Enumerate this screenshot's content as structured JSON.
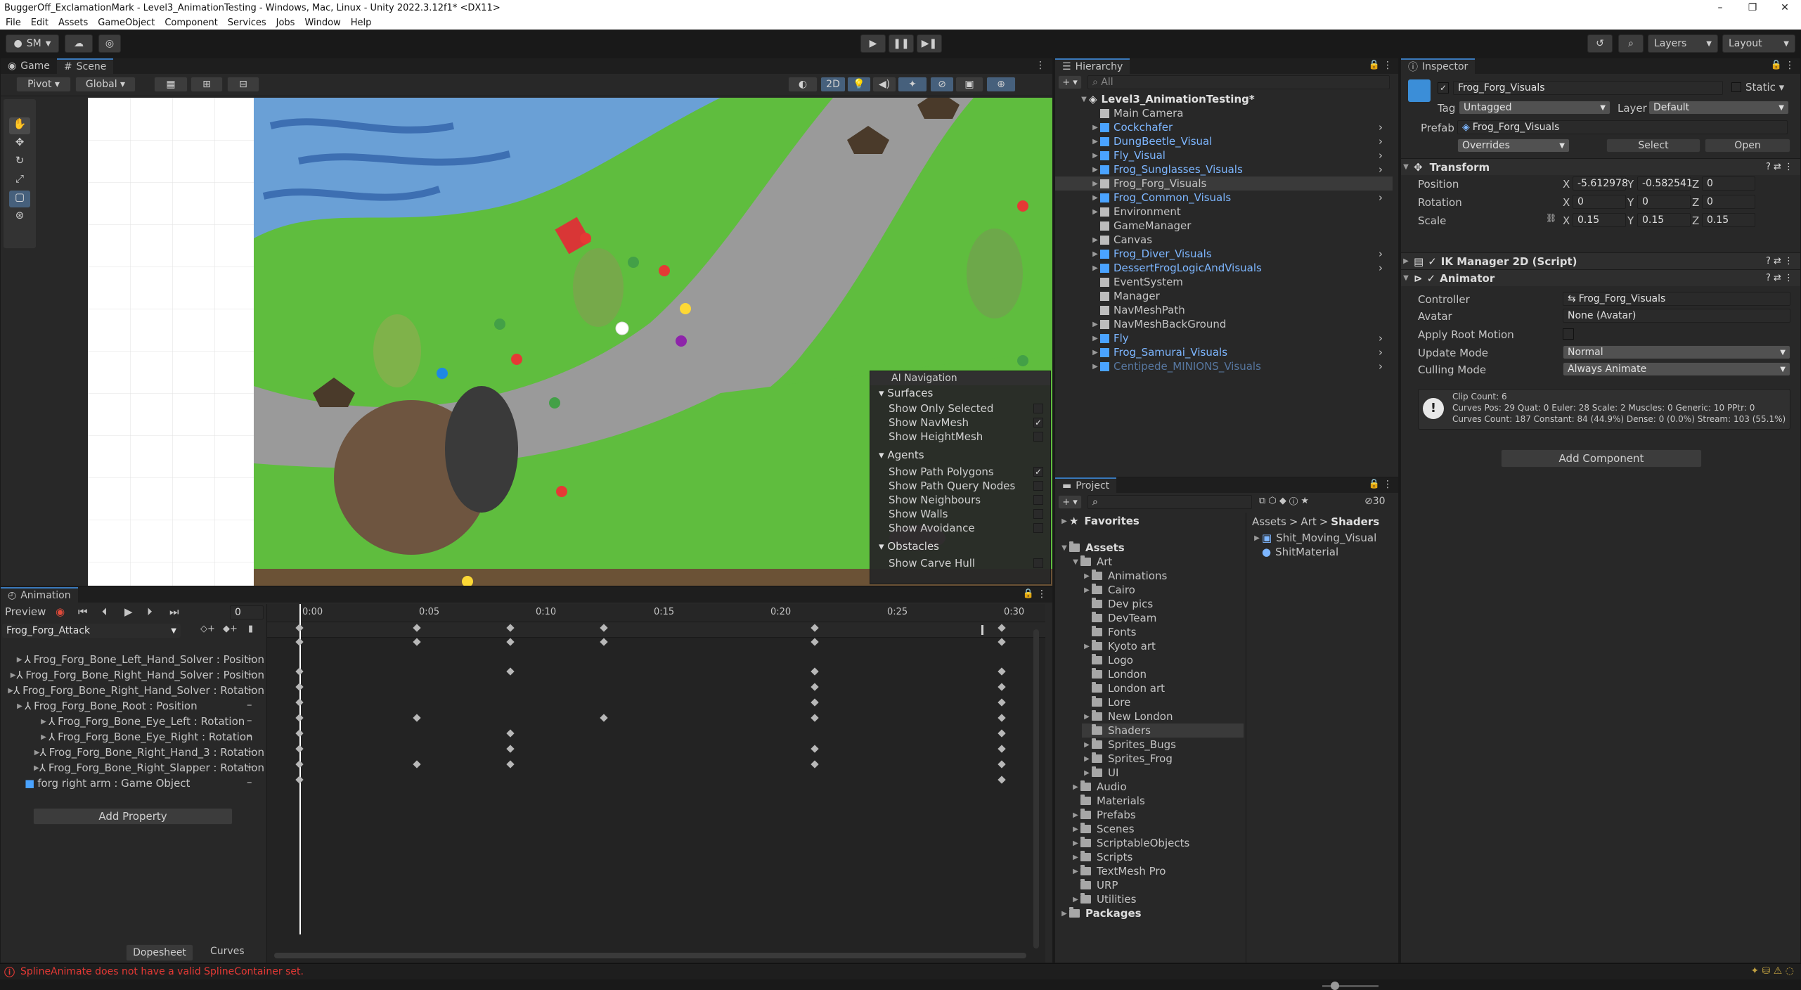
{
  "window": {
    "title": "BuggerOff_ExclamationMark - Level3_AnimationTesting - Windows, Mac, Linux - Unity 2022.3.12f1* <DX11>",
    "min": "–",
    "max": "❐",
    "close": "✕"
  },
  "menu": [
    "File",
    "Edit",
    "Assets",
    "GameObject",
    "Component",
    "Services",
    "Jobs",
    "Window",
    "Help"
  ],
  "toolbar": {
    "account": "SM",
    "layers": "Layers",
    "layout": "Layout"
  },
  "scene": {
    "tabs": [
      "Game",
      "Scene"
    ],
    "pivot": "Pivot",
    "global": "Global",
    "mode2d": "2D"
  },
  "ai_navigation": {
    "title": "AI Navigation",
    "surfaces": {
      "label": "Surfaces",
      "items": [
        {
          "label": "Show Only Selected",
          "checked": false
        },
        {
          "label": "Show NavMesh",
          "checked": true
        },
        {
          "label": "Show HeightMesh",
          "checked": false
        }
      ]
    },
    "agents": {
      "label": "Agents",
      "items": [
        {
          "label": "Show Path Polygons",
          "checked": true
        },
        {
          "label": "Show Path Query Nodes",
          "checked": false
        },
        {
          "label": "Show Neighbours",
          "checked": false
        },
        {
          "label": "Show Walls",
          "checked": false
        },
        {
          "label": "Show Avoidance",
          "checked": false
        }
      ]
    },
    "obstacles": {
      "label": "Obstacles",
      "items": [
        {
          "label": "Show Carve Hull",
          "checked": false
        }
      ]
    }
  },
  "hierarchy": {
    "tab": "Hierarchy",
    "search_placeholder": "All",
    "scene": "Level3_AnimationTesting*",
    "items": [
      {
        "label": "Main Camera",
        "prefab": false,
        "expand": false
      },
      {
        "label": "Cockchafer",
        "prefab": true,
        "expand": true
      },
      {
        "label": "DungBeetle_Visual",
        "prefab": true,
        "expand": true
      },
      {
        "label": "Fly_Visual",
        "prefab": true,
        "expand": true
      },
      {
        "label": "Frog_Sunglasses_Visuals",
        "prefab": true,
        "expand": true
      },
      {
        "label": "Frog_Forg_Visuals",
        "prefab": false,
        "expand": true,
        "selected": true
      },
      {
        "label": "Frog_Common_Visuals",
        "prefab": true,
        "expand": true
      },
      {
        "label": "Environment",
        "prefab": false,
        "expand": true
      },
      {
        "label": "GameManager",
        "prefab": false,
        "expand": false
      },
      {
        "label": "Canvas",
        "prefab": false,
        "expand": true
      },
      {
        "label": "Frog_Diver_Visuals",
        "prefab": true,
        "expand": true
      },
      {
        "label": "DessertFrogLogicAndVisuals",
        "prefab": true,
        "expand": true
      },
      {
        "label": "EventSystem",
        "prefab": false,
        "expand": false
      },
      {
        "label": "Manager",
        "prefab": false,
        "expand": false
      },
      {
        "label": "NavMeshPath",
        "prefab": false,
        "expand": false
      },
      {
        "label": "NavMeshBackGround",
        "prefab": false,
        "expand": true
      },
      {
        "label": "Fly",
        "prefab": true,
        "expand": true
      },
      {
        "label": "Frog_Samurai_Visuals",
        "prefab": true,
        "expand": true
      },
      {
        "label": "Centipede_MINIONS_Visuals",
        "prefab": true,
        "expand": true,
        "dim": true
      }
    ]
  },
  "inspector": {
    "tab": "Inspector",
    "object_name": "Frog_Forg_Visuals",
    "static": "Static",
    "tag_label": "Tag",
    "tag": "Untagged",
    "layer_label": "Layer",
    "layer": "Default",
    "prefab_label": "Prefab",
    "prefab": "Frog_Forg_Visuals",
    "overrides": "Overrides",
    "select": "Select",
    "open": "Open",
    "transform": {
      "title": "Transform",
      "position_label": "Position",
      "rotation_label": "Rotation",
      "scale_label": "Scale",
      "position": {
        "x": "-5.612978",
        "y": "-0.582541",
        "z": "0"
      },
      "rotation": {
        "x": "0",
        "y": "0",
        "z": "0"
      },
      "scale": {
        "x": "0.15",
        "y": "0.15",
        "z": "0.15"
      }
    },
    "ik_manager": "IK Manager 2D (Script)",
    "animator": {
      "title": "Animator",
      "controller_label": "Controller",
      "controller": "Frog_Forg_Visuals",
      "avatar_label": "Avatar",
      "avatar": "None (Avatar)",
      "root_motion_label": "Apply Root Motion",
      "update_mode_label": "Update Mode",
      "update_mode": "Normal",
      "culling_label": "Culling Mode",
      "culling": "Always Animate",
      "info": [
        "Clip Count: 6",
        "Curves Pos: 29 Quat: 0 Euler: 28 Scale: 2 Muscles: 0 Generic: 10 PPtr: 0",
        "Curves Count: 187 Constant: 84 (44.9%) Dense: 0 (0.0%) Stream: 103 (55.1%)"
      ]
    },
    "add_component": "Add Component"
  },
  "project": {
    "tab": "Project",
    "count": "30",
    "favorites": "Favorites",
    "breadcrumb": [
      "Assets",
      "Art",
      "Shaders"
    ],
    "tree": [
      {
        "label": "Assets",
        "level": 0,
        "arrow": "▼",
        "bold": true
      },
      {
        "label": "Art",
        "level": 1,
        "arrow": "▼"
      },
      {
        "label": "Animations",
        "level": 2,
        "arrow": "▶"
      },
      {
        "label": "Cairo",
        "level": 2,
        "arrow": "▶"
      },
      {
        "label": "Dev pics",
        "level": 2,
        "arrow": ""
      },
      {
        "label": "DevTeam",
        "level": 2,
        "arrow": ""
      },
      {
        "label": "Fonts",
        "level": 2,
        "arrow": ""
      },
      {
        "label": "Kyoto art",
        "level": 2,
        "arrow": "▶"
      },
      {
        "label": "Logo",
        "level": 2,
        "arrow": ""
      },
      {
        "label": "London",
        "level": 2,
        "arrow": ""
      },
      {
        "label": "London art",
        "level": 2,
        "arrow": ""
      },
      {
        "label": "Lore",
        "level": 2,
        "arrow": ""
      },
      {
        "label": "New London",
        "level": 2,
        "arrow": "▶"
      },
      {
        "label": "Shaders",
        "level": 2,
        "arrow": "",
        "selected": true
      },
      {
        "label": "Sprites_Bugs",
        "level": 2,
        "arrow": "▶"
      },
      {
        "label": "Sprites_Frog",
        "level": 2,
        "arrow": "▶"
      },
      {
        "label": "UI",
        "level": 2,
        "arrow": "▶"
      },
      {
        "label": "Audio",
        "level": 1,
        "arrow": "▶"
      },
      {
        "label": "Materials",
        "level": 1,
        "arrow": ""
      },
      {
        "label": "Prefabs",
        "level": 1,
        "arrow": "▶"
      },
      {
        "label": "Scenes",
        "level": 1,
        "arrow": "▶"
      },
      {
        "label": "ScriptableObjects",
        "level": 1,
        "arrow": "▶"
      },
      {
        "label": "Scripts",
        "level": 1,
        "arrow": "▶"
      },
      {
        "label": "TextMesh Pro",
        "level": 1,
        "arrow": "▶"
      },
      {
        "label": "URP",
        "level": 1,
        "arrow": ""
      },
      {
        "label": "Utilities",
        "level": 1,
        "arrow": "▶"
      },
      {
        "label": "Packages",
        "level": 0,
        "arrow": "▶",
        "bold": true
      }
    ],
    "files": [
      "Shit_Moving_Visual",
      "ShitMaterial"
    ]
  },
  "animation": {
    "tab": "Animation",
    "preview": "Preview",
    "frame": "0",
    "clip": "Frog_Forg_Attack",
    "ruler": [
      "0:00",
      "0:05",
      "0:10",
      "0:15",
      "0:20",
      "0:25",
      "0:30"
    ],
    "properties": [
      {
        "label": "Frog_Forg_Bone_Left_Hand_Solver : Position",
        "indent": 0
      },
      {
        "label": "Frog_Forg_Bone_Right_Hand_Solver : Position",
        "indent": 0
      },
      {
        "label": "Frog_Forg_Bone_Right_Hand_Solver : Rotation",
        "indent": 0
      },
      {
        "label": "Frog_Forg_Bone_Root : Position",
        "indent": 0
      },
      {
        "label": "Frog_Forg_Bone_Eye_Left : Rotation",
        "indent": 1
      },
      {
        "label": "Frog_Forg_Bone_Eye_Right : Rotation",
        "indent": 1
      },
      {
        "label": "Frog_Forg_Bone_Right_Hand_3 : Rotation",
        "indent": 2
      },
      {
        "label": "Frog_Forg_Bone_Right_Slapper : Rotation",
        "indent": 3
      },
      {
        "label": "forg right arm : Game Object",
        "indent": 0,
        "gameobject": true
      }
    ],
    "add_property": "Add Property",
    "dopesheet": "Dopesheet",
    "curves": "Curves"
  },
  "status": {
    "message": "SplineAnimate does not have a valid SplineContainer set."
  }
}
